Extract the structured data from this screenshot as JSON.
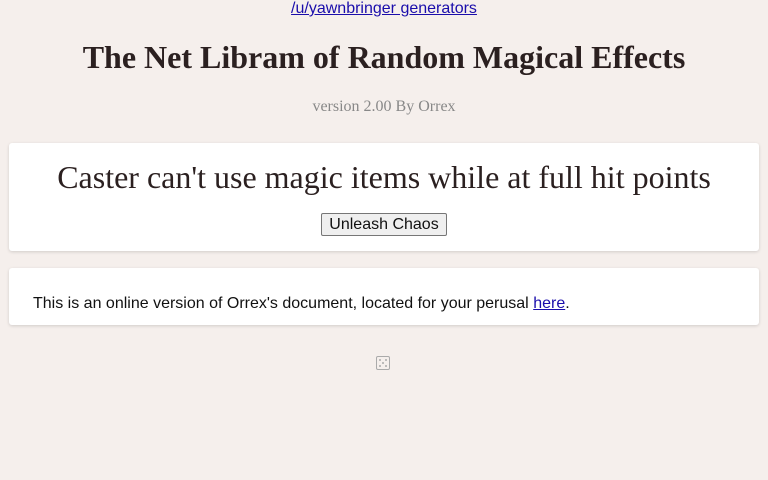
{
  "header": {
    "link_text": "/u/yawnbringer generators",
    "title": "The Net Libram of Random Magical Effects",
    "version": "version 2.00 By Orrex"
  },
  "effect": {
    "text": "Caster can't use magic items while at full hit points",
    "button_label": "Unleash Chaos"
  },
  "info": {
    "text": "This is an online version of Orrex's document, located for your perusal ",
    "link_text": "here",
    "suffix": "."
  },
  "icons": {
    "dice": "dice-icon"
  },
  "colors": {
    "background": "#f5efec",
    "link": "#1a0dab",
    "title": "#2b2020",
    "version": "#888888"
  }
}
